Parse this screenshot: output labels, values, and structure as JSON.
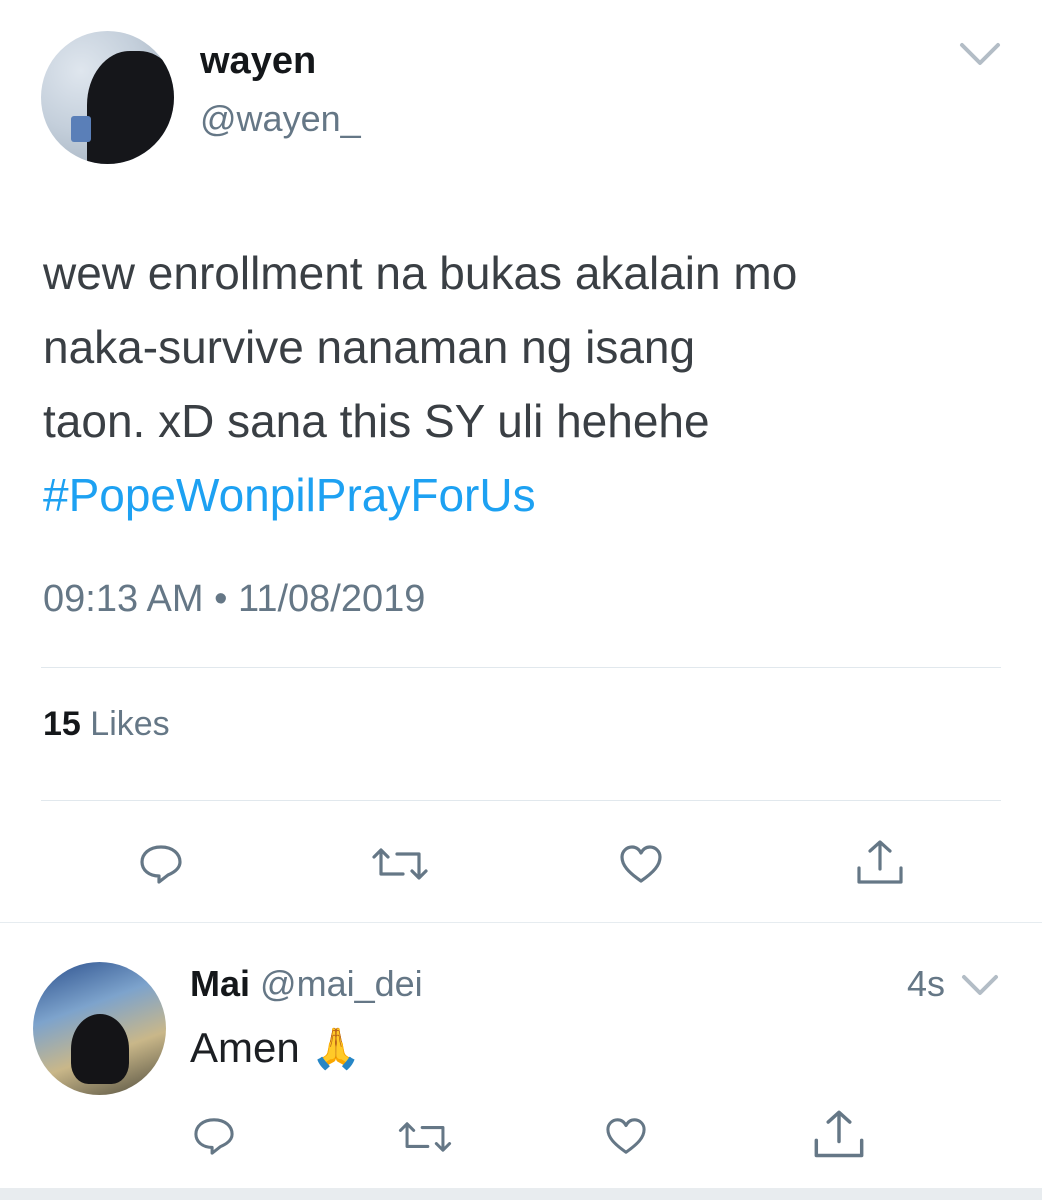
{
  "tweet": {
    "author_name": "wayen",
    "author_handle": "@wayen_",
    "text": "wew enrollment na bukas akalain mo\nnaka-survive nanaman ng isang\ntaon. xD sana this SY uli hehehe\n",
    "hashtag": "#PopeWonpilPrayForUs",
    "time": "09:13 AM",
    "separator": "•",
    "date": "11/08/2019",
    "likes_count": "15",
    "likes_label": "Likes"
  },
  "reply": {
    "author_name": "Mai",
    "author_handle": "@mai_dei",
    "age": "4s",
    "text": "Amen",
    "emoji": "🙏"
  },
  "icons": {
    "reply": "reply-icon",
    "retweet": "retweet-icon",
    "like": "heart-icon",
    "share": "share-icon",
    "menu": "chevron-down-icon"
  },
  "colors": {
    "link": "#1da1f2",
    "muted": "#657786",
    "divider": "#e1e8ed"
  }
}
